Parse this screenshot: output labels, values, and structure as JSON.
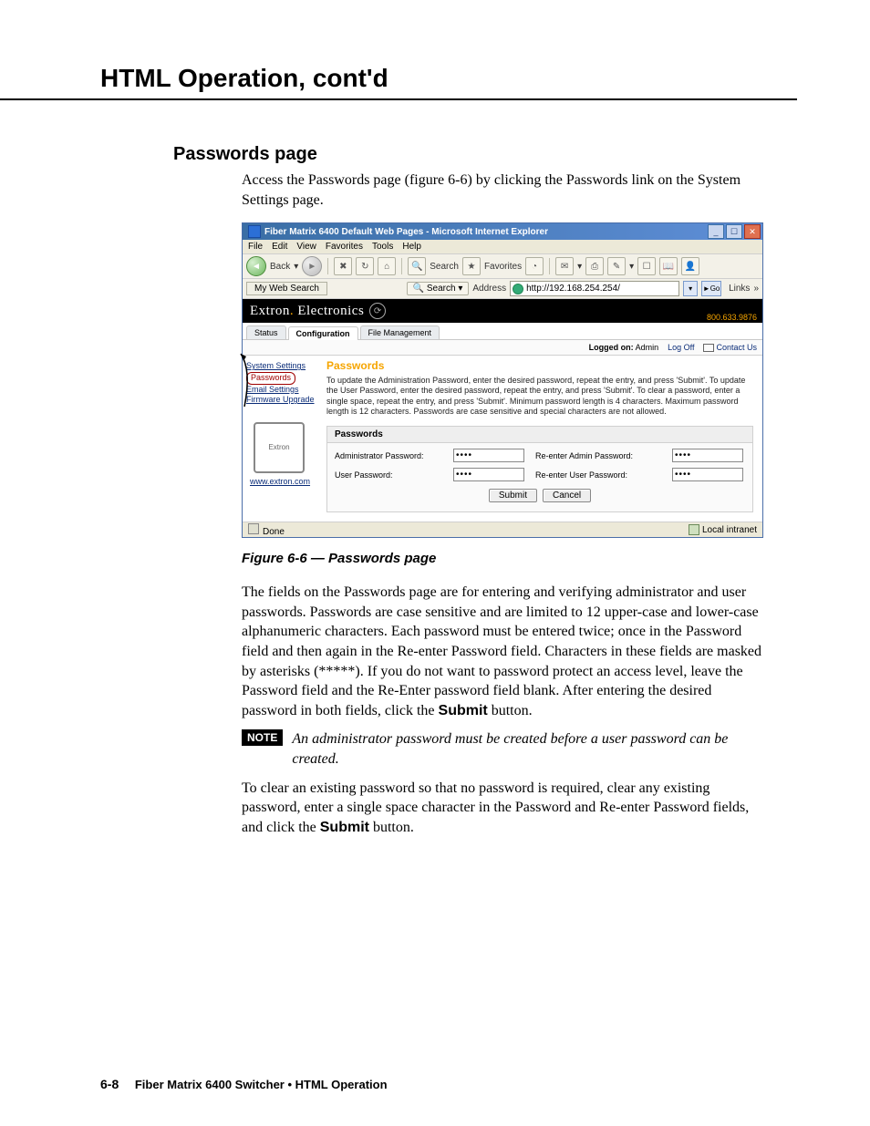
{
  "chapter_title": "HTML Operation, cont'd",
  "section_title": "Passwords page",
  "intro_text": "Access the Passwords page (figure 6-6) by clicking the Passwords link on the System Settings page.",
  "caption": "Figure 6-6 — Passwords page",
  "para1": "The fields on the Passwords page are for entering and verifying administrator and user passwords.  Passwords are case sensitive and are limited to 12 upper-case and lower-case alphanumeric characters.  Each password must be entered twice; once in the Password field and then again in the Re-enter Password field.  Characters in these fields are masked by asterisks (*****).  If you do not want to password protect an access level, leave the Password field and the Re-Enter password field blank.  After entering the desired password in both fields, click the ",
  "submit_word": "Submit",
  "para1_tail": " button.",
  "note_label": "NOTE",
  "note_text": "An administrator password must be created before a user password can be created.",
  "para2_a": "To clear an existing password so that no password is required, clear any existing password, enter a single space character in the Password and Re-enter Password fields, and click the ",
  "para2_tail": " button.",
  "footer_num": "6-8",
  "footer_text": "Fiber Matrix 6400 Switcher • HTML Operation",
  "ie": {
    "title": "Fiber Matrix 6400 Default Web Pages - Microsoft Internet Explorer",
    "menus": [
      "File",
      "Edit",
      "View",
      "Favorites",
      "Tools",
      "Help"
    ],
    "back": "Back",
    "search": "Search",
    "favorites": "Favorites",
    "myweb": "My Web Search",
    "search_btn": "Search",
    "address_label": "Address",
    "address_value": "http://192.168.254.254/",
    "go": "Go",
    "links": "Links",
    "done": "Done",
    "zone": "Local intranet"
  },
  "brand": {
    "name_a": "Extron",
    "name_b": "Electronics",
    "phone": "800.633.9876"
  },
  "tabs": {
    "status": "Status",
    "config": "Configuration",
    "files": "File Management"
  },
  "subbar": {
    "logged": "Logged on:",
    "who": "Admin",
    "logoff": "Log Off",
    "contact": "Contact Us"
  },
  "sidebar": {
    "system": "System Settings",
    "passwords": "Passwords",
    "email": "Email Settings",
    "firmware": "Firmware Upgrade",
    "url": "www.extron.com"
  },
  "panel": {
    "title": "Passwords",
    "desc": "To update the Administration Password, enter the desired password, repeat the entry, and press 'Submit'.  To update the User Password, enter the desired password, repeat the entry, and press 'Submit'.  To clear a password, enter a single space, repeat the entry, and press 'Submit'.  Minimum password length is 4 characters.  Maximum password length is 12 characters.  Passwords are case sensitive and special characters are not allowed.",
    "box_title": "Passwords",
    "admin_label": "Administrator Password:",
    "readmin_label": "Re-enter Admin Password:",
    "user_label": "User Password:",
    "reuser_label": "Re-enter User Password:",
    "mask": "••••",
    "submit": "Submit",
    "cancel": "Cancel"
  }
}
